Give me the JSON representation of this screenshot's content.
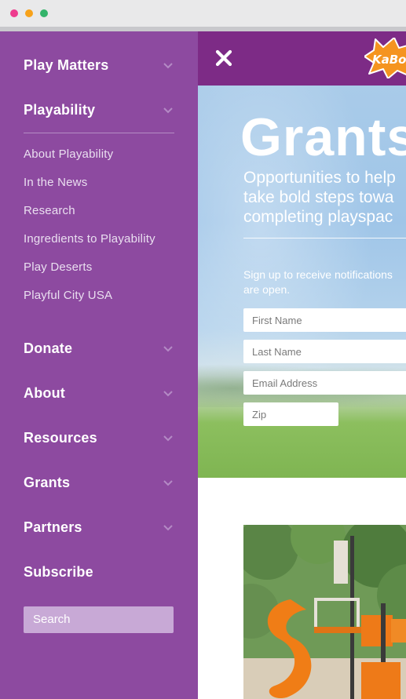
{
  "window": {
    "controls": [
      {
        "name": "close",
        "color": "#ee3b8e"
      },
      {
        "name": "minimize",
        "color": "#f7a21a"
      },
      {
        "name": "zoom",
        "color": "#33b36a"
      }
    ]
  },
  "colors": {
    "sidebar_bg": "#8d4aa0",
    "topbar_bg": "#7d2b86",
    "search_bg": "#c8a9d6",
    "chevron": "#b48ac5"
  },
  "sidebar": {
    "menu": [
      {
        "label": "Play Matters",
        "expandable": true,
        "icon": "chevron-down-icon"
      },
      {
        "label": "Playability",
        "expandable": true,
        "icon": "chevron-down-icon",
        "expanded": true,
        "subitems": [
          "About Playability",
          "In the News",
          "Research",
          "Ingredients to Playability",
          "Play Deserts",
          "Playful City USA"
        ]
      },
      {
        "label": "Donate",
        "expandable": true,
        "icon": "chevron-down-icon"
      },
      {
        "label": "About",
        "expandable": true,
        "icon": "chevron-down-icon"
      },
      {
        "label": "Resources",
        "expandable": true,
        "icon": "chevron-down-icon"
      },
      {
        "label": "Grants",
        "expandable": true,
        "icon": "chevron-down-icon"
      },
      {
        "label": "Partners",
        "expandable": true,
        "icon": "chevron-down-icon"
      },
      {
        "label": "Subscribe",
        "expandable": false
      }
    ],
    "search": {
      "placeholder": "Search",
      "icon": "search-field"
    }
  },
  "header": {
    "close_icon": "close-icon",
    "logo": {
      "text": "KaBo",
      "icon": "kaboom-logo"
    }
  },
  "hero": {
    "title": "Grants",
    "subtitle_lines": [
      "Opportunities to help",
      "take bold steps towa",
      "completing playspac"
    ],
    "signup_lines": [
      "Sign up to receive notifications",
      "are open."
    ],
    "fields": {
      "first_name": {
        "placeholder": "First Name",
        "value": ""
      },
      "last_name": {
        "placeholder": "Last Name",
        "value": ""
      },
      "email": {
        "placeholder": "Email Address",
        "value": ""
      },
      "zip": {
        "placeholder": "Zip",
        "value": ""
      }
    }
  },
  "content": {
    "photo_subject": "playground with orange spiral slide"
  }
}
